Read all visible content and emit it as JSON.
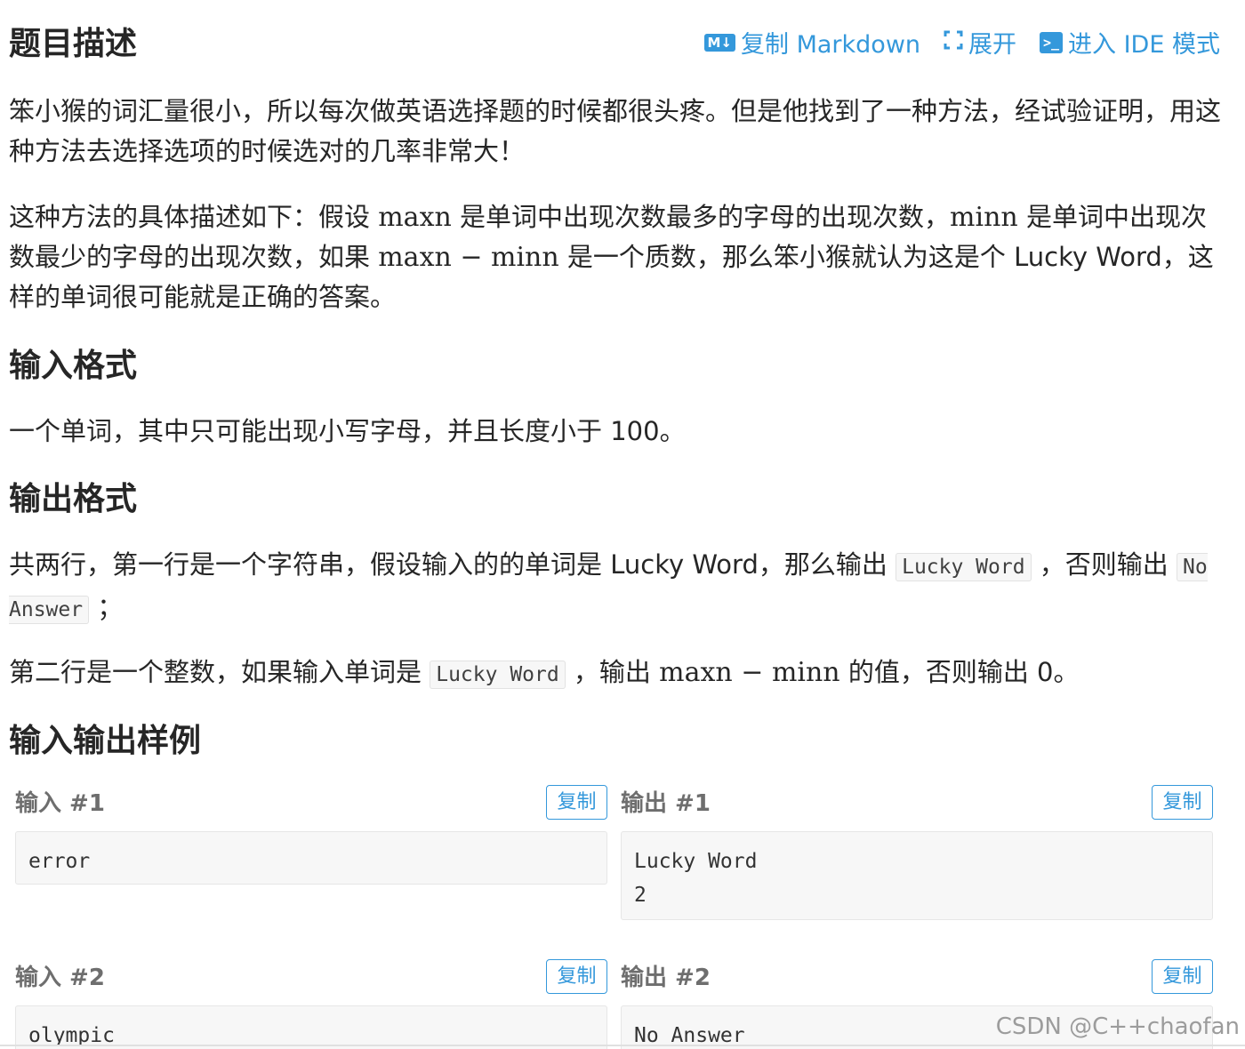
{
  "toolbar": {
    "markdown_icon": "M↓",
    "copy_markdown": "复制 Markdown",
    "expand_icon": "expand-icon",
    "expand": "展开",
    "ide_icon": ">_",
    "enter_ide": "进入 IDE 模式"
  },
  "sections": {
    "description_title": "题目描述",
    "input_title": "输入格式",
    "output_title": "输出格式",
    "samples_title": "输入输出样例"
  },
  "description": {
    "p1": "笨小猴的词汇量很小，所以每次做英语选择题的时候都很头疼。但是他找到了一种方法，经试验证明，用这种方法去选择选项的时候选对的几率非常大！",
    "p2_a": "这种方法的具体描述如下：假设 ",
    "p2_maxn": "maxn",
    "p2_b": " 是单词中出现次数最多的字母的出现次数，",
    "p2_minn": "minn",
    "p2_c": " 是单词中出现次数最少的字母的出现次数，如果 ",
    "p2_expr": "maxn − minn",
    "p2_d": " 是一个质数，那么笨小猴就认为这是个 Lucky Word，这样的单词很可能就是正确的答案。"
  },
  "input_format": {
    "text": "一个单词，其中只可能出现小写字母，并且长度小于 100。"
  },
  "output_format": {
    "l1_a": "共两行，第一行是一个字符串，假设输入的的单词是 Lucky Word，那么输出 ",
    "l1_code1": "Lucky Word",
    "l1_b": " ，否则输出 ",
    "l1_code2": "No Answer",
    "l1_c": " ；",
    "l2_a": "第二行是一个整数，如果输入单词是 ",
    "l2_code": "Lucky Word",
    "l2_b": " ，输出 ",
    "l2_expr": "maxn − minn",
    "l2_c": " 的值，否则输出 0。"
  },
  "samples": [
    {
      "label": "输入 #1",
      "copy": "复制",
      "content": "error"
    },
    {
      "label": "输出 #1",
      "copy": "复制",
      "content": "Lucky Word\n2"
    },
    {
      "label": "输入 #2",
      "copy": "复制",
      "content": "olympic"
    },
    {
      "label": "输出 #2",
      "copy": "复制",
      "content": "No Answer"
    }
  ],
  "watermark": "CSDN @C++chaofan",
  "colors": {
    "accent": "#3498db",
    "text": "#262626",
    "code_bg": "#f7f7f7"
  }
}
